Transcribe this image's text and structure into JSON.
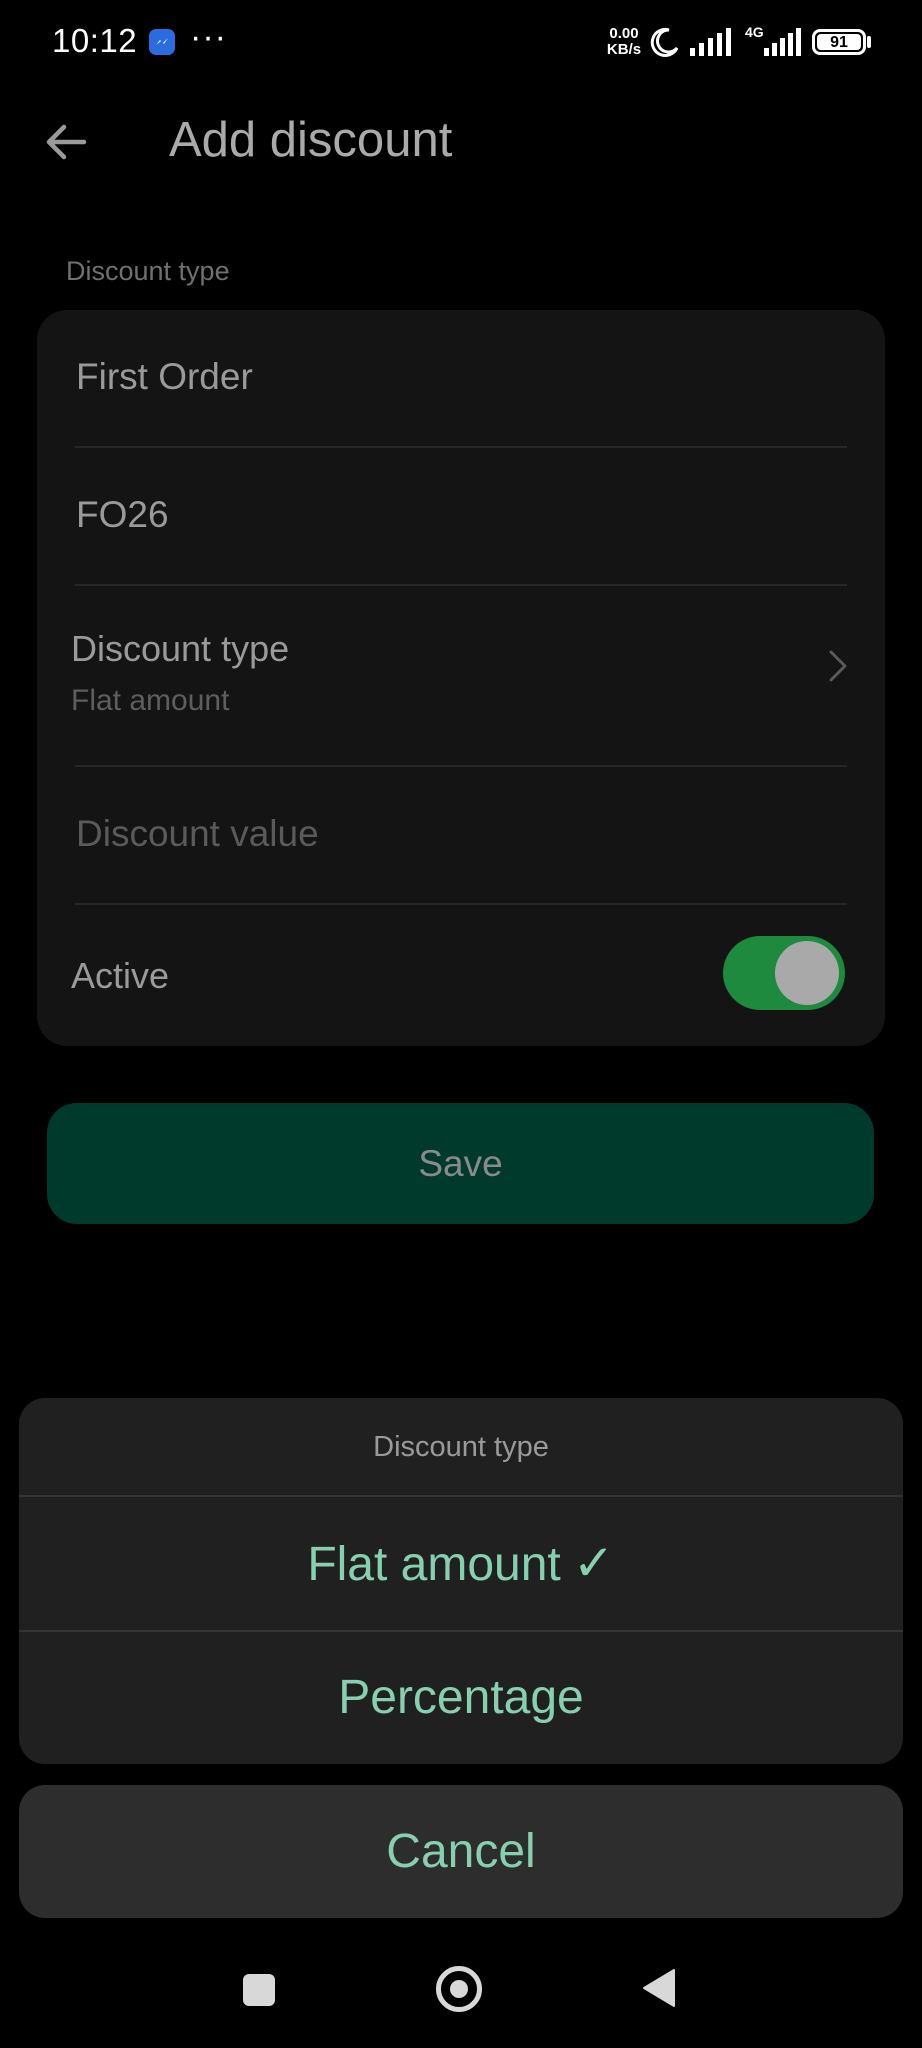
{
  "status_bar": {
    "time": "10:12",
    "more": "···",
    "net_speed_value": "0.00",
    "net_speed_unit": "KB/s",
    "network_type": "4G",
    "battery": "91"
  },
  "header": {
    "title": "Add discount"
  },
  "form": {
    "section_label": "Discount type",
    "name_value": "First Order",
    "code_value": "FO26",
    "discount_type_label": "Discount type",
    "discount_type_value": "Flat amount",
    "discount_value_placeholder": "Discount value",
    "active_label": "Active",
    "active_on": true,
    "save_label": "Save"
  },
  "action_sheet": {
    "title": "Discount type",
    "options": [
      {
        "label": "Flat amount",
        "selected": true,
        "check": "✓"
      },
      {
        "label": "Percentage",
        "selected": false
      }
    ],
    "cancel_label": "Cancel"
  },
  "colors": {
    "accent": "#86d0b0",
    "toggle_on": "#1e8a3e",
    "save_button": "#003a2c"
  },
  "icons": [
    "messenger-icon",
    "moon-icon",
    "signal-icon",
    "battery-icon",
    "back-arrow-icon",
    "chevron-right-icon",
    "check-icon",
    "nav-recents-icon",
    "nav-home-icon",
    "nav-back-icon"
  ]
}
